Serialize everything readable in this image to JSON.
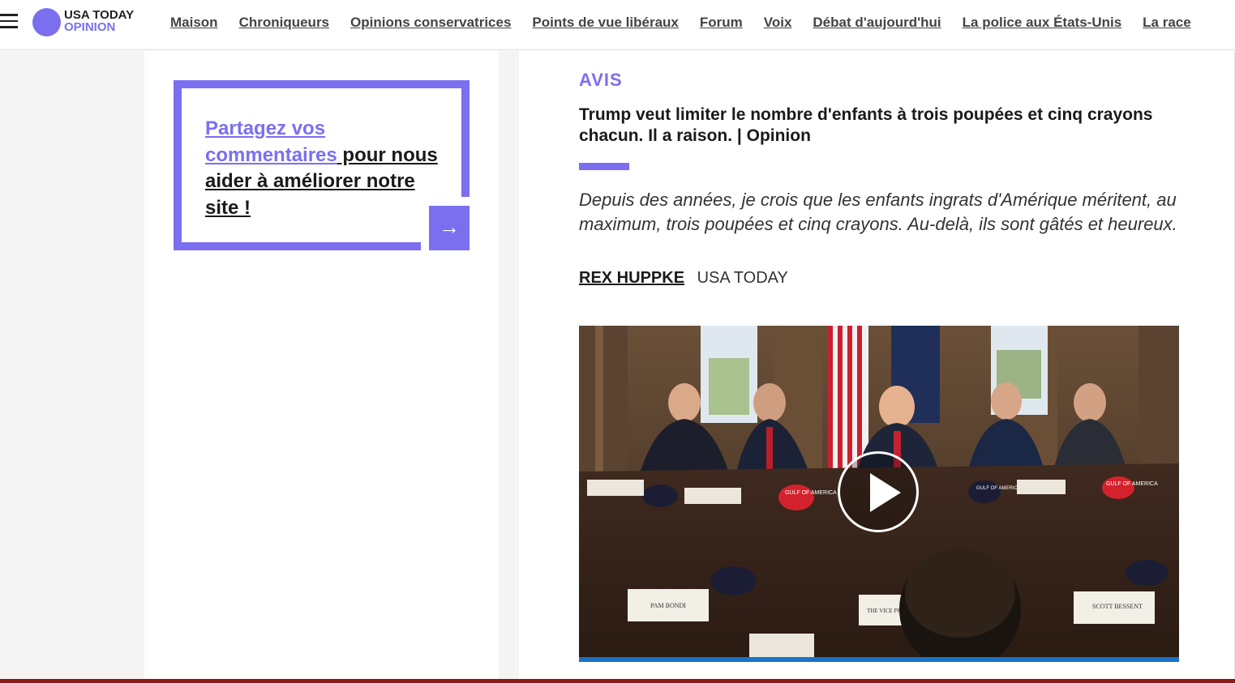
{
  "header": {
    "logo": {
      "line1": "USA TODAY",
      "line2": "OPINION"
    },
    "nav": [
      "Maison",
      "Chroniqueurs",
      "Opinions conservatrices",
      "Points de vue libéraux",
      "Forum",
      "Voix",
      "Débat d'aujourd'hui",
      "La police aux États-Unis",
      "La race"
    ]
  },
  "feedback": {
    "link_text": "Partagez vos commentaires",
    "rest_text": " pour nous aider à améliorer notre site !"
  },
  "article": {
    "label": "AVIS",
    "headline": "Trump veut limiter le nombre d'enfants à trois poupées et cinq crayons chacun. Il a raison. | Opinion",
    "summary": "Depuis des années, je crois que les enfants ingrats d'Amérique méritent, au maximum, trois poupées et cinq crayons. Au-delà, ils sont gâtés et heureux.",
    "author": "REX HUPPKE",
    "outlet": "USA TODAY"
  },
  "video": {
    "caps": [
      "GULF OF AMERICA",
      "GULF OF AMERICA",
      "GULF OF AMERICA"
    ],
    "nameplates": [
      "PAM BONDI",
      "THE VICE PRESIDENT",
      "SCOTT BESSENT"
    ]
  },
  "colors": {
    "accent": "#7b6ff0",
    "progress": "#1a73c8"
  }
}
